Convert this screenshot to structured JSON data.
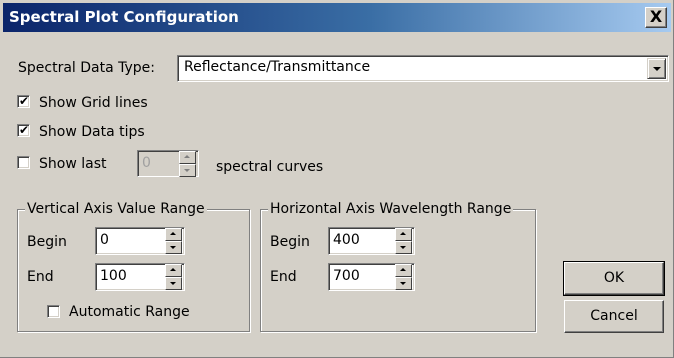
{
  "window": {
    "title": "Spectral Plot Configuration",
    "close_label": "X"
  },
  "data_type": {
    "label": "Spectral Data Type:",
    "value": "Reflectance/Transmittance"
  },
  "options": {
    "show_grid": {
      "label": "Show Grid lines",
      "checked": true
    },
    "show_tips": {
      "label": "Show Data tips",
      "checked": true
    },
    "show_last": {
      "label": "Show last",
      "checked": false,
      "value": "0",
      "suffix": "spectral curves"
    }
  },
  "vertical_range": {
    "title": "Vertical Axis Value Range",
    "begin_label": "Begin",
    "begin_value": "0",
    "end_label": "End",
    "end_value": "100",
    "auto_label": "Automatic Range",
    "auto_checked": false
  },
  "horizontal_range": {
    "title": "Horizontal Axis Wavelength Range",
    "begin_label": "Begin",
    "begin_value": "400",
    "end_label": "End",
    "end_value": "700"
  },
  "buttons": {
    "ok": "OK",
    "cancel": "Cancel"
  }
}
